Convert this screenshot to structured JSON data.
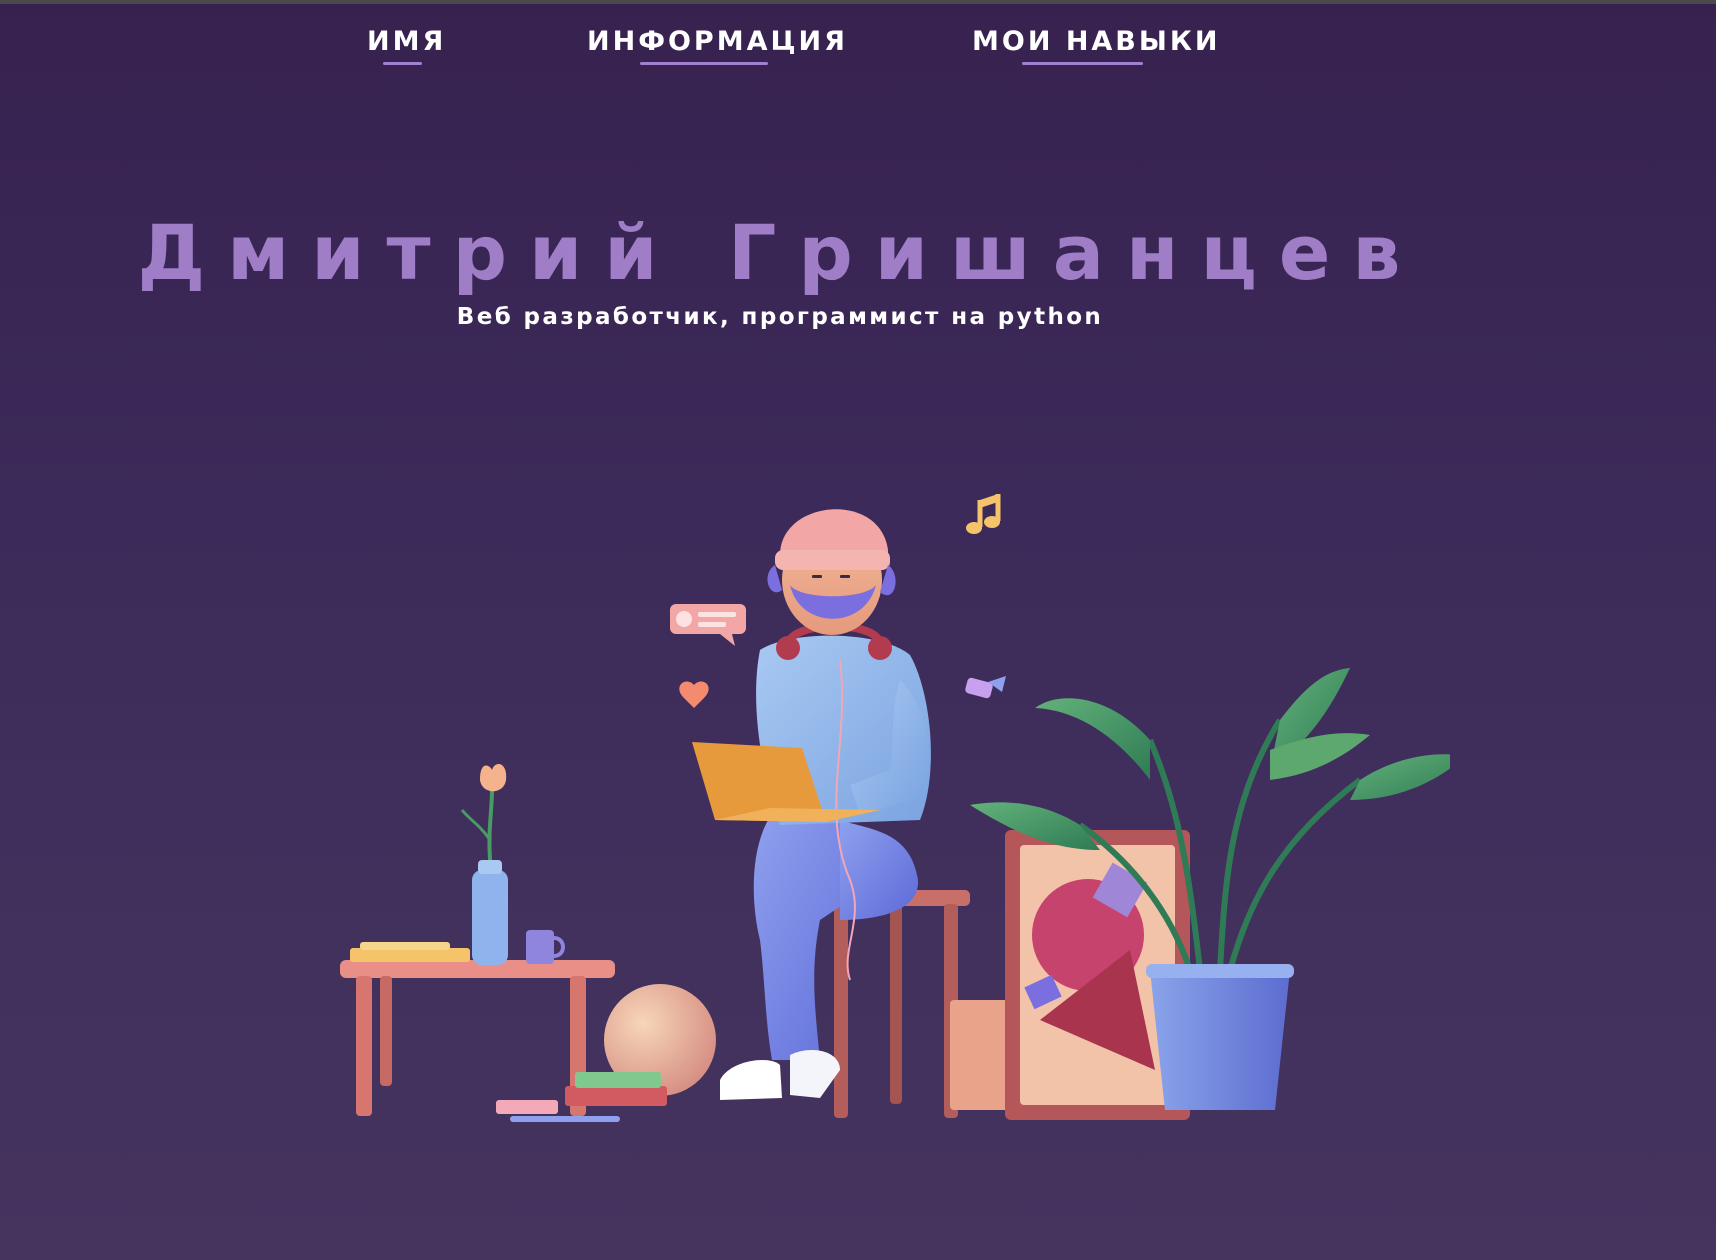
{
  "nav": {
    "items": [
      {
        "label": "ИМЯ"
      },
      {
        "label": "ИНФОРМАЦИЯ"
      },
      {
        "label": "МОИ НАВЫКИ"
      }
    ]
  },
  "hero": {
    "name": "Дмитрий Гришанцев",
    "tagline": "Веб разработчик, программист на python"
  },
  "illustration": {
    "icon": "developer-with-laptop-illustration"
  },
  "colors": {
    "background": "#3c2a5a",
    "accent": "#9f7ec7",
    "nav_underline": "#a37fd0",
    "text": "#ffffff"
  }
}
